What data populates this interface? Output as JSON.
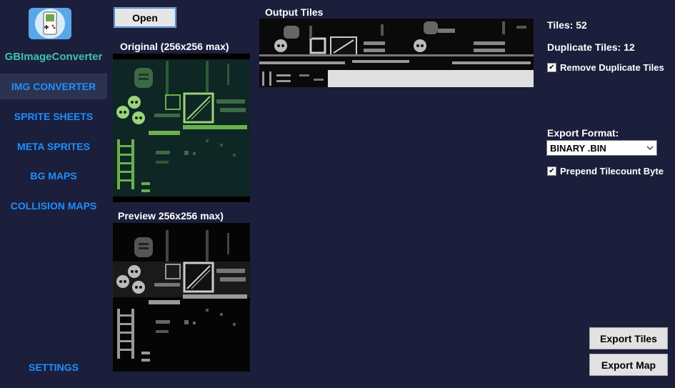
{
  "app": {
    "name": "GBImageConverter"
  },
  "sidebar": {
    "items": [
      {
        "label": "IMG CONVERTER",
        "active": true
      },
      {
        "label": "SPRITE SHEETS",
        "active": false
      },
      {
        "label": "META SPRITES",
        "active": false
      },
      {
        "label": "BG MAPS",
        "active": false
      },
      {
        "label": "COLLISION MAPS",
        "active": false
      }
    ],
    "settings_label": "SETTINGS"
  },
  "toolbar": {
    "open_label": "Open"
  },
  "panels": {
    "original_title": "Original (256x256 max)",
    "preview_title": "Preview 256x256 max)",
    "output_title": "Output Tiles"
  },
  "stats": {
    "tiles": "Tiles: 52",
    "duplicate_tiles": "Duplicate Tiles: 12"
  },
  "options": {
    "remove_duplicates_label": "Remove Duplicate Tiles",
    "remove_duplicates_checked": true,
    "export_format_label": "Export Format:",
    "export_format_value": "BINARY .BIN",
    "prepend_tilecount_label": "Prepend Tilecount Byte",
    "prepend_tilecount_checked": true
  },
  "actions": {
    "export_tiles_label": "Export Tiles",
    "export_map_label": "Export Map"
  },
  "colors": {
    "background": "#1b1f3c",
    "accent": "#1e8fff",
    "app_name": "#3ec0b0",
    "gb_dark": "#0f2a28",
    "gb_light": "#8fce6a"
  },
  "icons": {
    "logo": "gameboy-icon",
    "dropdown": "chevron-down-icon",
    "check": "checkmark-icon"
  }
}
